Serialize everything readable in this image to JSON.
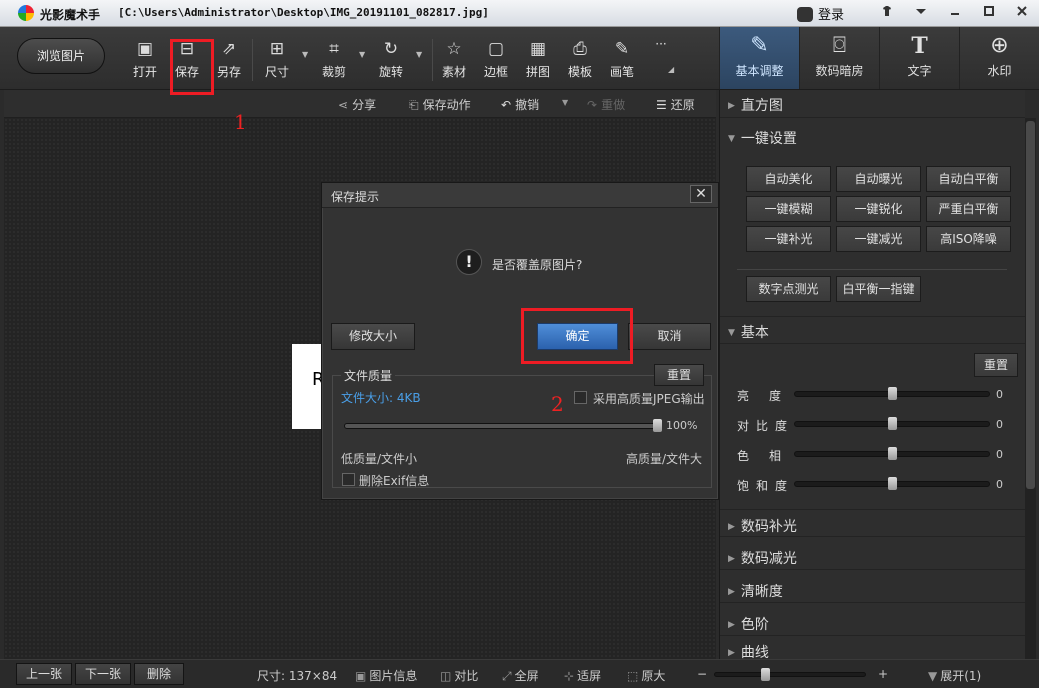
{
  "titlebar": {
    "app_name": "光影魔术手",
    "file_path": "[C:\\Users\\Administrator\\Desktop\\IMG_20191101_082817.jpg]",
    "login": "登录"
  },
  "toolbar": {
    "browse": "浏览图片",
    "open": "打开",
    "save": "保存",
    "save_as": "另存",
    "size": "尺寸",
    "crop": "裁剪",
    "rotate": "旋转",
    "material": "素材",
    "border": "边框",
    "collage": "拼图",
    "template": "模板",
    "brush": "画笔",
    "more": "···"
  },
  "right_tabs": {
    "basic": "基本调整",
    "darkroom": "数码暗房",
    "text": "文字",
    "watermark": "水印"
  },
  "subbar": {
    "share": "分享",
    "save_action": "保存动作",
    "undo": "撤销",
    "redo": "重做",
    "restore": "还原"
  },
  "annotations": {
    "step1": "1",
    "step2": "2"
  },
  "dialog": {
    "title": "保存提示",
    "close": "✕",
    "message": "是否覆盖原图片?",
    "resize": "修改大小",
    "ok": "确定",
    "cancel": "取消",
    "quality_group": "文件质量",
    "reset": "重置",
    "file_size": "文件大小: 4KB",
    "hq_jpeg": "采用高质量JPEG输出",
    "quality_value": 100,
    "quality_pct": "100%",
    "low_quality": "低质量/文件小",
    "high_quality": "高质量/文件大",
    "remove_exif": "删除Exif信息"
  },
  "panel": {
    "histogram": "直方图",
    "oneclick": "一键设置",
    "oneclick_buttons": [
      "自动美化",
      "自动曝光",
      "自动白平衡",
      "一键模糊",
      "一键锐化",
      "严重白平衡",
      "一键补光",
      "一键减光",
      "高ISO降噪"
    ],
    "extra_buttons": [
      "数字点测光",
      "白平衡一指键"
    ],
    "basic": "基本",
    "reset": "重置",
    "sliders": [
      {
        "label": "亮度",
        "value": "0",
        "position": 0.5
      },
      {
        "label": "对比度",
        "value": "0",
        "position": 0.5
      },
      {
        "label": "色相",
        "value": "0",
        "position": 0.5
      },
      {
        "label": "饱和度",
        "value": "0",
        "position": 0.5
      }
    ],
    "sections": [
      "数码补光",
      "数码减光",
      "清晰度",
      "色阶",
      "曲线"
    ]
  },
  "statusbar": {
    "prev": "上一张",
    "next": "下一张",
    "delete": "删除",
    "size": "尺寸: 137×84",
    "info": "图片信息",
    "compare": "对比",
    "fullscreen": "全屏",
    "fit": "适屏",
    "original": "原大",
    "zoom_minus": "−",
    "zoom_plus": "+",
    "expand": "展开(1)"
  },
  "preview_char": "R"
}
